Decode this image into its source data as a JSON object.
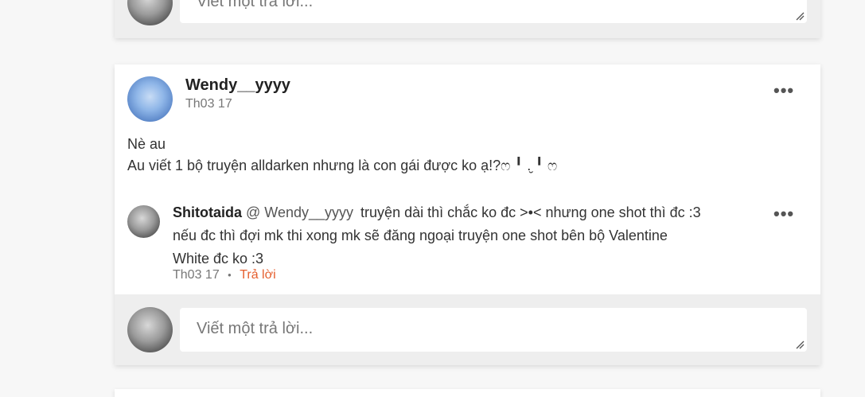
{
  "top_card": {
    "reply_placeholder": "Viết một trả lời..."
  },
  "comment": {
    "username": "Wendy__yyyy",
    "time": "Th03 17",
    "body_line1": "Nè au",
    "body_line2": "Au viết 1 bộ truyện alldarken nhưng là con gái được ko ạ!?ෆ ╹ .̮ ╹ ෆ",
    "more_label": "•••",
    "reply": {
      "username": "Shitotaida",
      "mention": "@ Wendy__yyyy",
      "text_line1": "truyện dài thì chắc ko đc >•< nhưng one shot thì đc :3",
      "text_line2": "nếu đc thì đợi mk thi xong mk sẽ đăng ngoại truyện one shot bên bộ Valentine",
      "text_line3": "White đc ko :3",
      "time": "Th03 17",
      "separator": "•",
      "reply_link": "Trả lời",
      "more_label": "•••"
    },
    "reply_placeholder": "Viết một trả lời..."
  }
}
